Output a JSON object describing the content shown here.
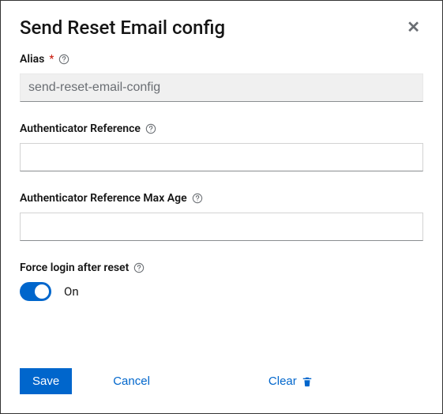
{
  "title": "Send Reset Email config",
  "fields": {
    "alias": {
      "label": "Alias",
      "value": "send-reset-email-config"
    },
    "authRef": {
      "label": "Authenticator Reference",
      "value": ""
    },
    "authRefMaxAge": {
      "label": "Authenticator Reference Max Age",
      "value": ""
    },
    "forceLogin": {
      "label": "Force login after reset",
      "stateLabel": "On"
    }
  },
  "buttons": {
    "save": "Save",
    "cancel": "Cancel",
    "clear": "Clear"
  }
}
